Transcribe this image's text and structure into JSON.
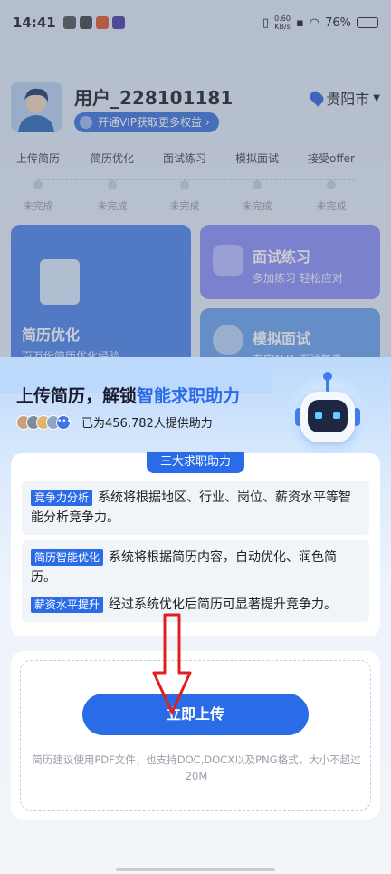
{
  "status_bar": {
    "time": "14:41",
    "net_speed_value": "0.60",
    "net_speed_unit": "KB/s",
    "battery": "76%",
    "battery_level": 0.76
  },
  "profile": {
    "username": "用户_228101181",
    "vip_label": "开通VIP获取更多权益",
    "city": "贵阳市"
  },
  "steps": [
    {
      "label": "上传简历",
      "status": "未完成"
    },
    {
      "label": "简历优化",
      "status": "未完成"
    },
    {
      "label": "面试练习",
      "status": "未完成"
    },
    {
      "label": "模拟面试",
      "status": "未完成"
    },
    {
      "label": "接受offer",
      "status": "未完成"
    }
  ],
  "feature_cards": {
    "resume": {
      "title": "简历优化",
      "subtitle": "百万份简历优化经验"
    },
    "interview": {
      "title": "面试练习",
      "subtitle": "多加练习 轻松应对"
    },
    "mock": {
      "title": "模拟面试",
      "subtitle": "专家1V1 面试复盘"
    }
  },
  "sheet": {
    "title_prefix": "上传简历，解锁",
    "title_highlight": "智能求职助力",
    "supporters_text": "已为456,782人提供助力",
    "benefits_tag": "三大求职助力",
    "benefits": [
      {
        "badge": "竞争力分析",
        "text": "系统将根据地区、行业、岗位、薪资水平等智能分析竞争力。"
      },
      {
        "badge": "简历智能优化",
        "text": "系统将根据简历内容，自动优化、润色简历。"
      },
      {
        "badge": "薪资水平提升",
        "text": "经过系统优化后简历可显著提升竞争力。"
      }
    ],
    "upload_button": "立即上传",
    "upload_hint": "简历建议使用PDF文件，也支持DOC,DOCX以及PNG格式，大小不超过20M"
  },
  "colors": {
    "accent": "#2a6be8",
    "annotation_arrow": "#e02020"
  }
}
